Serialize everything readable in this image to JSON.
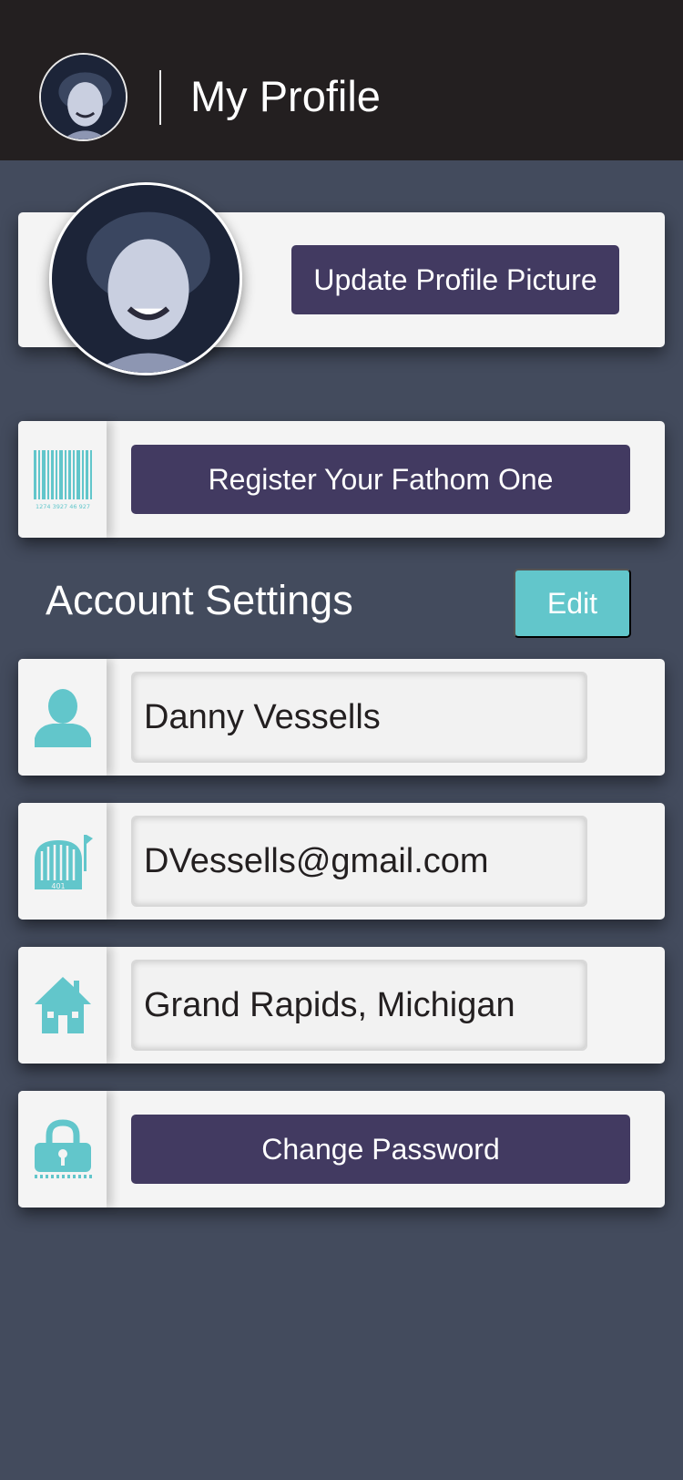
{
  "header": {
    "title": "My Profile"
  },
  "profile": {
    "update_picture_label": "Update Profile Picture"
  },
  "register": {
    "button_label": "Register Your Fathom One",
    "barcode_number": "1274 3927 46 927"
  },
  "account": {
    "title": "Account Settings",
    "edit_label": "Edit",
    "name": "Danny Vessells",
    "email": "DVessells@gmail.com",
    "location": "Grand Rapids, Michigan",
    "mailbox_number": "401",
    "change_password_label": "Change Password"
  },
  "colors": {
    "accent": "#62c6cb",
    "button": "#423a61",
    "header": "#231f20",
    "background": "#434b5d"
  }
}
